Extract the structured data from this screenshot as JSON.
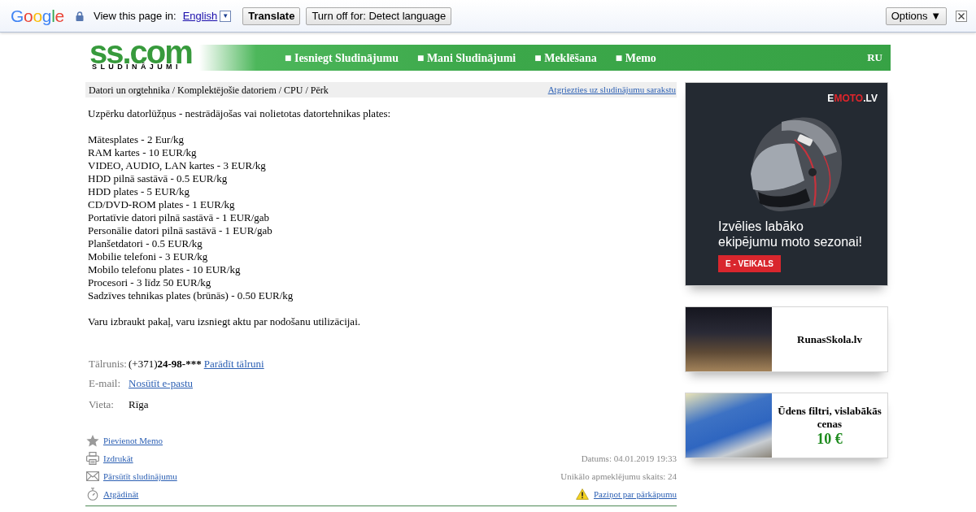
{
  "translate_bar": {
    "logo": "Google",
    "prompt": "View this page in:",
    "language": "English",
    "language_dropdown": "▼",
    "buttons": [
      {
        "label": "Translate",
        "kind": "primary"
      },
      {
        "label": "Turn off for: Detect language",
        "kind": "secondary"
      }
    ],
    "options": "Options ▼"
  },
  "header": {
    "logo": "ss.com",
    "logo_subtitle": "SLUDINĀJUMI",
    "nav": [
      "■ Iesniegt Sludinājumu",
      "■ Mani Sludinājumi",
      "■ Meklēšana",
      "■ Memo"
    ],
    "language": "RU"
  },
  "breadcrumb": {
    "path": "Datori un orgtehnika / Komplektējošie datoriem / CPU / Pērk",
    "back_link": "Atgriezties uz sludinājumu sarakstu"
  },
  "description": {
    "intro": "Uzpērku datorlūžņus - nestrādājošas vai nolietotas datortehnikas plates:",
    "items": [
      "Mātesplates - 2 Eur/kg",
      "RAM kartes - 10 EUR/kg",
      "VIDEO, AUDIO, LAN kartes - 3 EUR/kg",
      "HDD pilnā sastāvā - 0.5 EUR/kg",
      "HDD plates - 5 EUR/kg",
      "CD/DVD-ROM plates - 1 EUR/kg",
      "Portatīvie datori pilnā sastāvā - 1 EUR/gab",
      "Personālie datori pilnā sastāvā - 1 EUR/gab",
      "Planšetdatori - 0.5 EUR/kg",
      "Mobilie telefoni - 3 EUR/kg",
      "Mobilo telefonu plates - 10 EUR/kg",
      "Procesori - 3 līdz 50 EUR/kg",
      "Sadzīves tehnikas plates (brūnās) - 0.50 EUR/kg"
    ],
    "outro": "Varu izbraukt pakaļ, varu izsniegt aktu par nodošanu utilizācijai."
  },
  "contacts": [
    {
      "kind": "phone",
      "label": "Tālrunis:",
      "prefix": "(+371)",
      "number": "24-98-***",
      "link": "Parādīt tālruni"
    },
    {
      "kind": "email",
      "label": "E-mail:",
      "link": "Nosūtīt e-pastu"
    },
    {
      "kind": "place",
      "label": "Vieta:",
      "value": "Rīga"
    }
  ],
  "actions": [
    {
      "kind": "memo",
      "label": "Pievienot Memo"
    },
    {
      "kind": "print",
      "label": "Izdrukāt"
    },
    {
      "kind": "forward",
      "label": "Pārsūtīt sludinājumu"
    },
    {
      "kind": "remind",
      "label": "Atgādināt"
    }
  ],
  "meta": {
    "date": "Datums: 04.01.2019 19:33",
    "views": "Unikālo apmeklējumu skaits: 24",
    "report": "Paziņot par pārkāpumu"
  },
  "ads": [
    {
      "kind": "banner",
      "brand": "EMOTO.LV",
      "headline_lines": [
        "Izvēlies labāko",
        "ekipējumu moto sezonai!"
      ],
      "button": "E - VEIKALS"
    },
    {
      "kind": "card",
      "title": "RunasSkola.lv"
    },
    {
      "kind": "card",
      "title": "Ūdens filtri, vislabākās cenas",
      "price": "10 €"
    }
  ]
}
